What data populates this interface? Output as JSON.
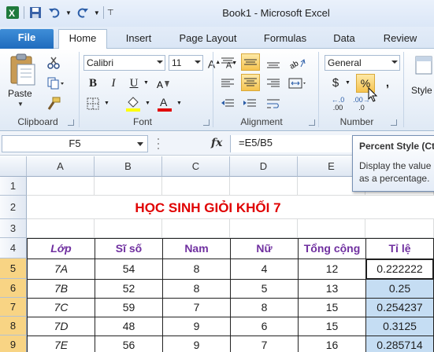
{
  "window": {
    "title": "Book1 - Microsoft Excel"
  },
  "tabs": [
    "File",
    "Home",
    "Insert",
    "Page Layout",
    "Formulas",
    "Data",
    "Review"
  ],
  "ribbon": {
    "clipboard": {
      "label": "Clipboard",
      "paste": "Paste"
    },
    "font": {
      "label": "Font",
      "name": "Calibri",
      "size": "11",
      "bold": "B",
      "italic": "I",
      "underline": "U",
      "grow": "A",
      "shrink": "A"
    },
    "alignment": {
      "label": "Alignment"
    },
    "number": {
      "label": "Number",
      "format": "General",
      "currency": "$",
      "percent": "%",
      "comma": ",",
      "inc_decimal": ".00",
      "dec_decimal": ".0"
    },
    "styles": {
      "label": "Style"
    }
  },
  "formula_bar": {
    "cell_ref": "F5",
    "fx": "fx",
    "formula": "=E5/B5"
  },
  "tooltip": {
    "title": "Percent Style (Ctrl+Shift+%)",
    "desc": "Display the value of the cell as a percentage."
  },
  "sheet": {
    "columns": [
      "A",
      "B",
      "C",
      "D",
      "E",
      "F"
    ],
    "rows": [
      "1",
      "2",
      "3",
      "4",
      "5",
      "6",
      "7",
      "8",
      "9"
    ],
    "title": "HỌC SINH GIỎI KHỐI 7",
    "headers": [
      "Lớp",
      "Sĩ số",
      "Nam",
      "Nữ",
      "Tổng cộng",
      "Tỉ lệ"
    ],
    "data": [
      [
        "7A",
        "54",
        "8",
        "4",
        "12",
        "0.222222"
      ],
      [
        "7B",
        "52",
        "8",
        "5",
        "13",
        "0.25"
      ],
      [
        "7C",
        "59",
        "7",
        "8",
        "15",
        "0.254237"
      ],
      [
        "7D",
        "48",
        "9",
        "6",
        "15",
        "0.3125"
      ],
      [
        "7E",
        "56",
        "9",
        "7",
        "16",
        "0.285714"
      ]
    ]
  }
}
